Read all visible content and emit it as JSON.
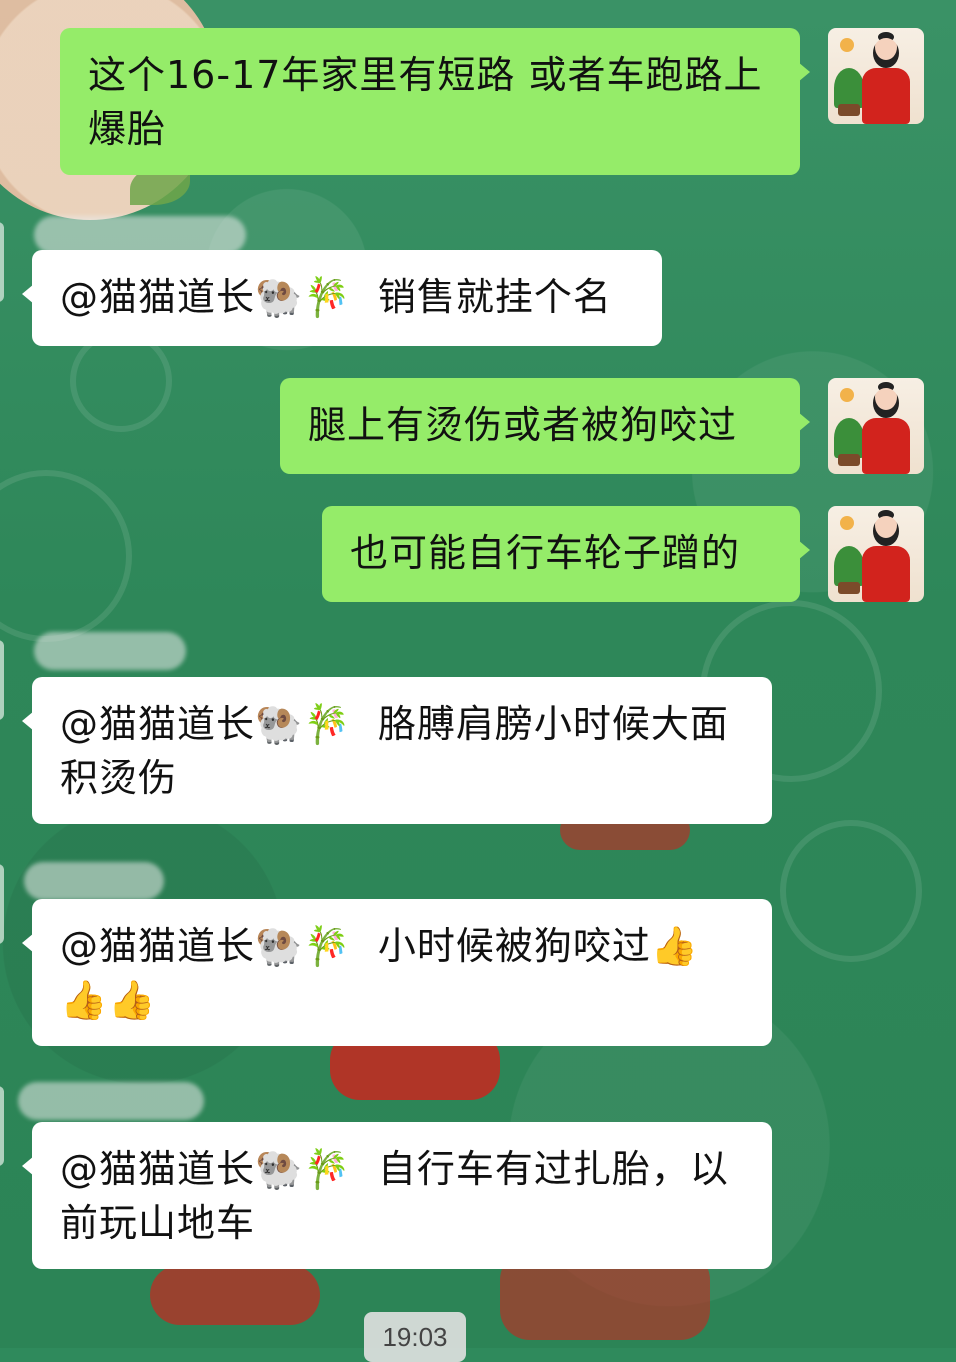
{
  "messages": [
    {
      "id": "m1",
      "direction": "out",
      "text": "这个16-17年家里有短路  或者车跑路上爆胎"
    },
    {
      "id": "m2",
      "direction": "in",
      "mention": "@猫猫道长",
      "emojis": "🐏🎋",
      "text": "销售就挂个名"
    },
    {
      "id": "m3",
      "direction": "out",
      "text": "腿上有烫伤或者被狗咬过"
    },
    {
      "id": "m4",
      "direction": "out",
      "text": "也可能自行车轮子蹭的"
    },
    {
      "id": "m5",
      "direction": "in",
      "mention": "@猫猫道长",
      "emojis": "🐏🎋",
      "text": "胳膊肩膀小时候大面积烫伤"
    },
    {
      "id": "m6",
      "direction": "in",
      "mention": "@猫猫道长",
      "emojis": "🐏🎋",
      "text": "小时候被狗咬过",
      "trailing_emojis": "👍👍👍"
    },
    {
      "id": "m7",
      "direction": "in",
      "mention": "@猫猫道长",
      "emojis": "🐏🎋",
      "text": "自行车有过扎胎，以前玩山地车"
    }
  ],
  "timestamp": "19:03",
  "colors": {
    "outgoing_bubble": "#95ec69",
    "incoming_bubble": "#ffffff",
    "background": "#2f8a5c"
  }
}
